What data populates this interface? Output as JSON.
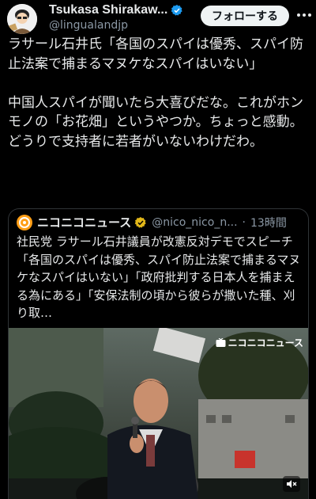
{
  "author": {
    "name": "Tsukasa Shirakaw...",
    "handle": "@lingualandjp",
    "verified": true
  },
  "follow_label": "フォローする",
  "more_icon": "more-icon",
  "post": {
    "paragraph1": "ラサール石井氏「各国のスパイは優秀、スパイ防止法案で捕まるマヌケなスパイはいない」",
    "paragraph2": "中国人スパイが聞いたら大喜びだな。これがホンモノの「お花畑」というやつか。ちょっと感動。どうりで支持者に若者がいないわけだわ。"
  },
  "quoted": {
    "name": "ニコニコニュース",
    "handle": "@nico_nico_n...",
    "separator": "·",
    "time": "13時間",
    "text": "社民党 ラサール石井議員が改憲反対デモでスピーチ「各国のスパイは優秀、スパイ防止法案で捕まるマヌケなスパイはいない」「政府批判する日本人を捕まえる為にある」「安保法制の頃から彼らが撒いた種、刈り取…",
    "watermark": "ニコニコニュース"
  },
  "icons": {
    "verified": "verified-badge-icon",
    "gold_badge": "gold-verified-badge-icon",
    "mute": "mute-icon",
    "logo": "niconico-logo-icon"
  },
  "colors": {
    "background": "#000000",
    "text": "#e7e9ea",
    "muted": "#8b98a5",
    "verified_blue": "#1d9bf0",
    "gold": "#e2b719",
    "logo_orange": "#ff9e16"
  }
}
